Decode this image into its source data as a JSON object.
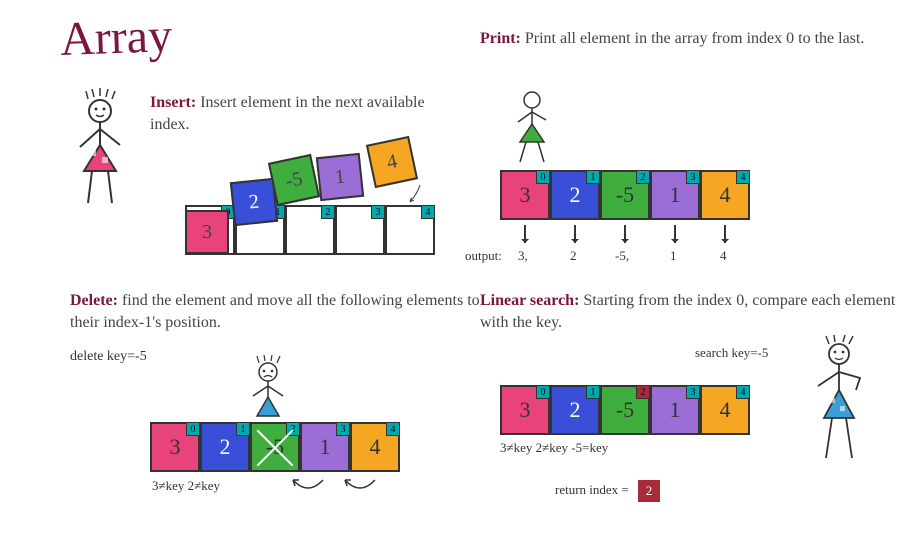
{
  "title": "Array",
  "insert": {
    "op": "Insert:",
    "text": "Insert element in the next available index.",
    "base_idx": [
      "0",
      "1",
      "2",
      "3",
      "4"
    ],
    "floats": [
      {
        "v": "3",
        "color": "c-pink"
      },
      {
        "v": "2",
        "color": "c-blue"
      },
      {
        "v": "-5",
        "color": "c-green"
      },
      {
        "v": "1",
        "color": "c-purple"
      },
      {
        "v": "4",
        "color": "c-orange"
      }
    ]
  },
  "print": {
    "op": "Print:",
    "text": "Print all element in the array from index 0 to the last.",
    "cells": [
      {
        "v": "3",
        "i": "0",
        "color": "c-pink"
      },
      {
        "v": "2",
        "i": "1",
        "color": "c-blue"
      },
      {
        "v": "-5",
        "i": "2",
        "color": "c-green"
      },
      {
        "v": "1",
        "i": "3",
        "color": "c-purple"
      },
      {
        "v": "4",
        "i": "4",
        "color": "c-orange"
      }
    ],
    "output_label": "output:",
    "output_vals": [
      "3,",
      "2",
      "-5,",
      "1",
      "4"
    ]
  },
  "delete": {
    "op": "Delete:",
    "text": "find the element and move all the following elements to their index-1's position.",
    "key_label": "delete key=-5",
    "cells": [
      {
        "v": "3",
        "i": "0",
        "color": "c-pink"
      },
      {
        "v": "2",
        "i": "1",
        "color": "c-blue"
      },
      {
        "v": "-5",
        "i": "2",
        "color": "c-green"
      },
      {
        "v": "1",
        "i": "3",
        "color": "c-purple"
      },
      {
        "v": "4",
        "i": "4",
        "color": "c-orange"
      }
    ],
    "annot": "3≠key 2≠key"
  },
  "search": {
    "op": "Linear search:",
    "text": "Starting from the index 0, compare each element with the key.",
    "key_label": "search key=-5",
    "cells": [
      {
        "v": "3",
        "i": "0",
        "color": "c-pink"
      },
      {
        "v": "2",
        "i": "1",
        "color": "c-blue"
      },
      {
        "v": "-5",
        "i": "2",
        "color": "c-green",
        "hit": true
      },
      {
        "v": "1",
        "i": "3",
        "color": "c-purple"
      },
      {
        "v": "4",
        "i": "4",
        "color": "c-orange"
      }
    ],
    "annot": "3≠key   2≠key  -5=key",
    "ret_label": "return index =",
    "ret_val": "2"
  }
}
